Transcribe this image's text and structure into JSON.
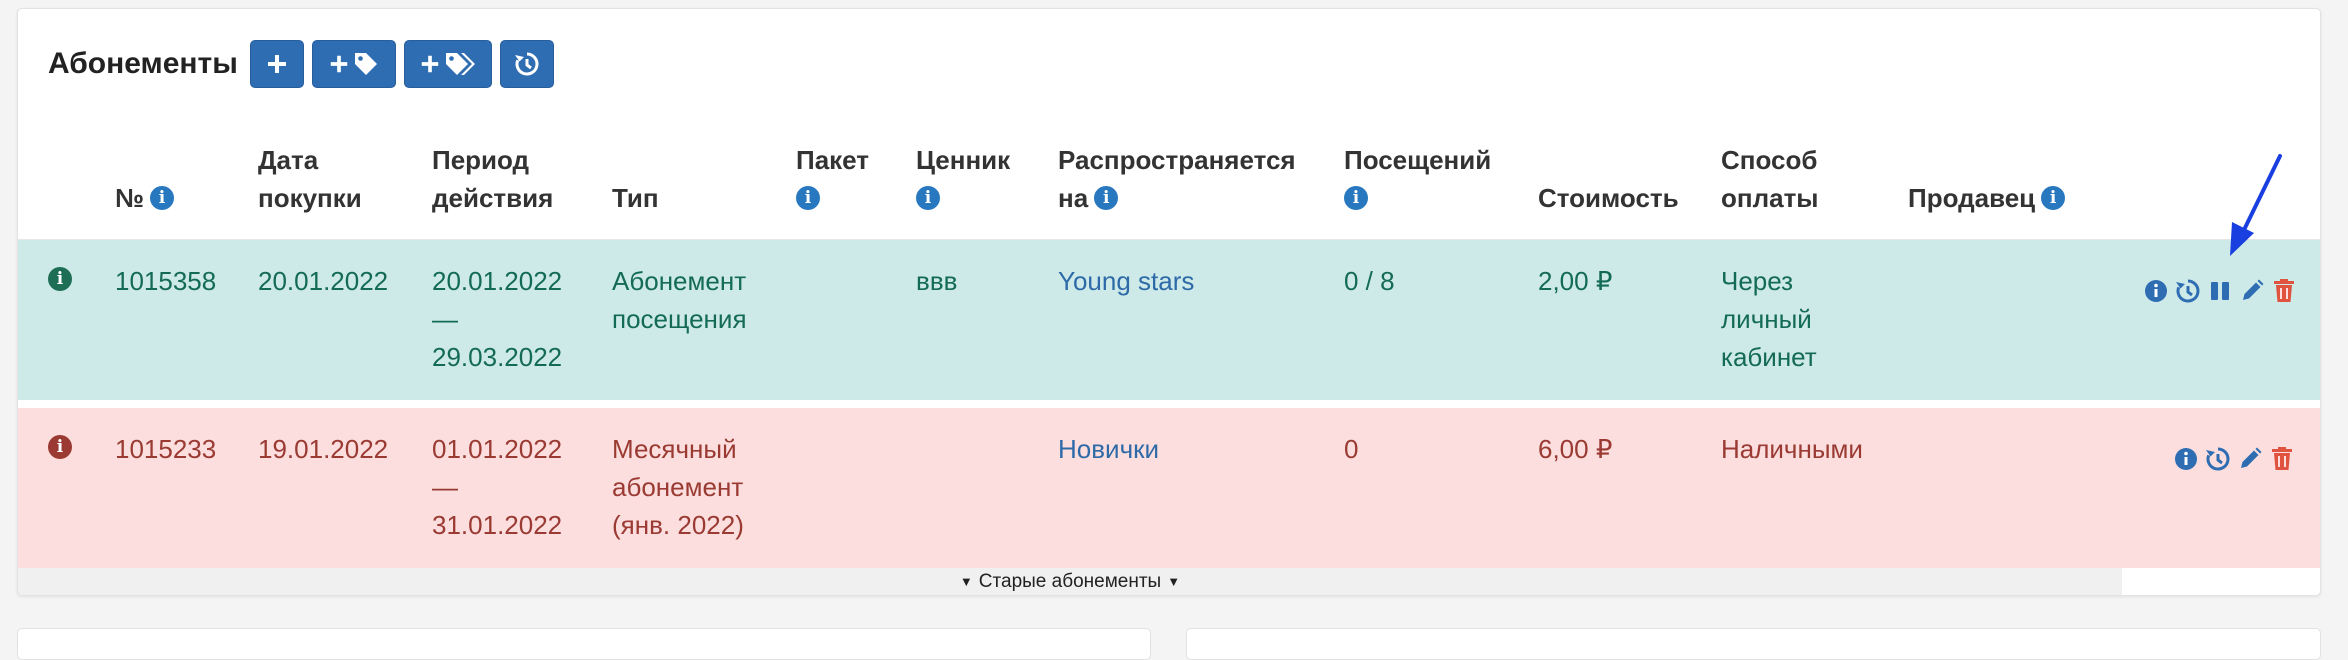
{
  "header": {
    "title": "Абонементы",
    "buttons": [
      {
        "name": "add-subscription-button",
        "icon": "plus"
      },
      {
        "name": "add-tag-button",
        "icon": "plus-tag"
      },
      {
        "name": "add-tags-button",
        "icon": "plus-tags"
      },
      {
        "name": "history-button",
        "icon": "history"
      }
    ]
  },
  "columns": {
    "number": "№",
    "purchase_date": [
      "Дата",
      "покупки"
    ],
    "period": [
      "Период",
      "действия"
    ],
    "type": "Тип",
    "package": "Пакет",
    "pricelist": "Ценник",
    "applies_to": [
      "Распространяется",
      "на"
    ],
    "visits": "Посещений",
    "cost": "Стоимость",
    "payment": [
      "Способ",
      "оплаты"
    ],
    "seller": "Продавец"
  },
  "rows": [
    {
      "status": "active",
      "status_color": "#1d6e55",
      "number": "1015358",
      "purchase_date": "20.01.2022",
      "period_start": "20.01.2022",
      "period_dash": "—",
      "period_end": "29.03.2022",
      "type": [
        "Абонемент",
        "посещения"
      ],
      "package": "",
      "pricelist": "ввв",
      "applies_to": "Young stars",
      "visits": "0 / 8",
      "cost": "2,00 ₽",
      "payment": [
        "Через",
        "личный",
        "кабинет"
      ],
      "seller": "",
      "actions": [
        "info-icon",
        "history-icon",
        "pause-icon",
        "edit-icon",
        "delete-icon"
      ]
    },
    {
      "status": "expired",
      "status_color": "#9a3a33",
      "number": "1015233",
      "purchase_date": "19.01.2022",
      "period_start": "01.01.2022",
      "period_dash": "—",
      "period_end": "31.01.2022",
      "type": [
        "Месячный",
        "абонемент",
        "(янв. 2022)"
      ],
      "package": "",
      "pricelist": "",
      "applies_to": "Новички",
      "visits": "0",
      "cost": "6,00 ₽",
      "payment": [
        "Наличными"
      ],
      "seller": "",
      "actions": [
        "info-icon",
        "history-icon",
        "edit-icon",
        "delete-icon"
      ]
    }
  ],
  "footer": {
    "old_link": "Старые абонементы"
  },
  "colors": {
    "primary": "#2f6db3",
    "green_row": "#cdeae8",
    "red_row": "#fbdedd",
    "delete": "#e0533f",
    "annotation_arrow": "#1a3fe0"
  }
}
